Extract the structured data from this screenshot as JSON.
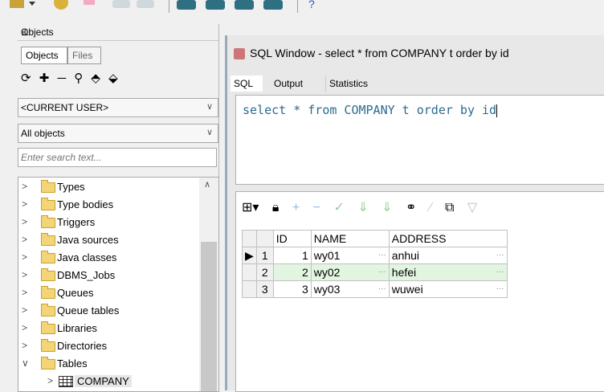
{
  "toolbar": {
    "icons": [
      "wrench-icon",
      "dropdown-icon",
      "gear-icon",
      "pencil-icon",
      "db-disabled-icon",
      "db-disabled-icon",
      "database-icon",
      "database-icon",
      "database-icon",
      "database-icon",
      "help-icon"
    ]
  },
  "objects_panel": {
    "title": "Objects",
    "pin": "⊥",
    "close": "×",
    "tabs": [
      {
        "label": "Objects"
      },
      {
        "label": "Files"
      }
    ],
    "tools": "⟳ ✚ ─ ⚲ ⬘ ⬙",
    "user_combo": "<CURRENT USER>",
    "filter_combo": "All objects",
    "search_placeholder": "Enter search text...",
    "tree": [
      {
        "label": "Types",
        "chev": ">"
      },
      {
        "label": "Type bodies",
        "chev": ">"
      },
      {
        "label": "Triggers",
        "chev": ">"
      },
      {
        "label": "Java sources",
        "chev": ">"
      },
      {
        "label": "Java classes",
        "chev": ">"
      },
      {
        "label": "DBMS_Jobs",
        "chev": ">"
      },
      {
        "label": "Queues",
        "chev": ">"
      },
      {
        "label": "Queue tables",
        "chev": ">"
      },
      {
        "label": "Libraries",
        "chev": ">"
      },
      {
        "label": "Directories",
        "chev": ">"
      },
      {
        "label": "Tables",
        "chev": "∨"
      },
      {
        "label": "COMPANY",
        "chev": ">"
      }
    ]
  },
  "sql_window": {
    "title": "SQL Window - select * from COMPANY t order by id",
    "tabs": [
      {
        "label": "SQL"
      },
      {
        "label": "Output"
      },
      {
        "label": "Statistics"
      }
    ],
    "query": "select * from COMPANY t order by id",
    "result_tools": [
      "grid-icon",
      "lock-icon",
      "plus-icon",
      "minus-icon",
      "check-icon",
      "arrow-down-icon",
      "arrow-down-icon",
      "binoculars-icon",
      "eraser-icon",
      "export-icon",
      "filter-icon"
    ],
    "columns": [
      "ID",
      "NAME",
      "ADDRESS"
    ],
    "rows": [
      {
        "num": "1",
        "id": "1",
        "name": "wy01",
        "address": "anhui"
      },
      {
        "num": "2",
        "id": "2",
        "name": "wy02",
        "address": "hefei"
      },
      {
        "num": "3",
        "id": "3",
        "name": "wy03",
        "address": "wuwei"
      }
    ],
    "colors": {
      "query_text": "#2c6b8e",
      "selected_row": "#e2f5e0"
    }
  }
}
